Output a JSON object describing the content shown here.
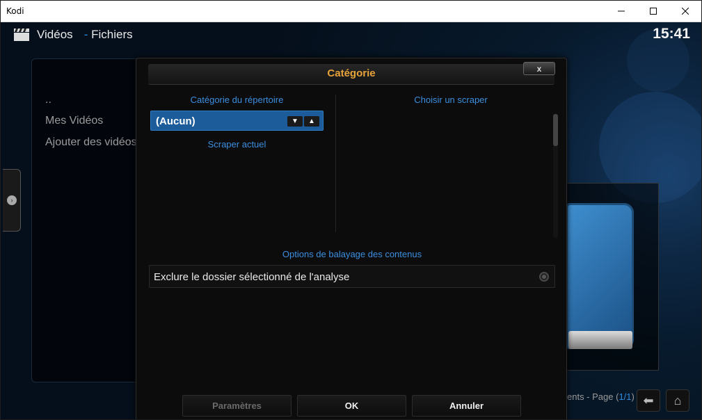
{
  "window": {
    "title": "Kodi"
  },
  "header": {
    "section": "Vidéos",
    "separator": "-",
    "subsection": "Fichiers",
    "clock": "15:41"
  },
  "file_list": {
    "items": [
      "..",
      "Mes Vidéos",
      "Ajouter des vidéos"
    ]
  },
  "footer": {
    "text": "ents - Page (",
    "page": "1/1",
    "close": ")"
  },
  "dialog": {
    "title": "Catégorie",
    "close_label": "x",
    "dir_category_label": "Catégorie du répertoire",
    "dir_category_value": "(Aucun)",
    "current_scraper_label": "Scraper actuel",
    "choose_scraper_label": "Choisir un scraper",
    "scan_options_label": "Options de balayage des contenus",
    "exclude_option_label": "Exclure le dossier sélectionné de l'analyse",
    "exclude_option_checked": false,
    "buttons": {
      "settings": "Paramètres",
      "ok": "OK",
      "cancel": "Annuler"
    }
  },
  "colors": {
    "accent_orange": "#e8a23a",
    "accent_blue": "#3b8fe0",
    "highlight": "#1c5c9a"
  }
}
